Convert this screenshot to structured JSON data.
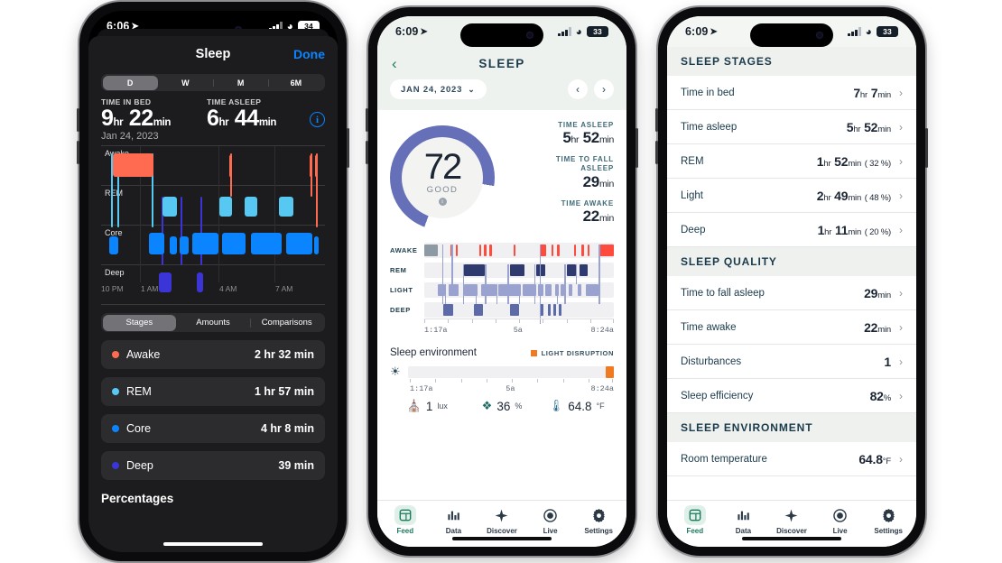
{
  "phone1": {
    "status": {
      "time": "6:06",
      "location_icon": "location-arrow-icon",
      "signal_icon": "cellular-bars-icon",
      "wifi_icon": "wifi-icon",
      "battery": "34"
    },
    "nav": {
      "title": "Sleep",
      "done_label": "Done"
    },
    "segmented": {
      "options": [
        "D",
        "W",
        "M",
        "6M"
      ],
      "selected": "D"
    },
    "stats": [
      {
        "label": "TIME IN BED",
        "hours": "9",
        "hr_unit": "hr",
        "minutes": "22",
        "min_unit": "min"
      },
      {
        "label": "TIME ASLEEP",
        "hours": "6",
        "hr_unit": "hr",
        "minutes": "44",
        "min_unit": "min"
      }
    ],
    "info_icon": "info-circle-icon",
    "date": "Jan 24, 2023",
    "chart": {
      "rows": [
        "Awake",
        "REM",
        "Core",
        "Deep"
      ],
      "xticks": [
        "10 PM",
        "1 AM",
        "4 AM",
        "7 AM"
      ]
    },
    "tabs": {
      "options": [
        "Stages",
        "Amounts",
        "Comparisons"
      ],
      "selected": "Stages"
    },
    "legend_rows": [
      {
        "name": "Awake",
        "value": "2 hr 32 min",
        "color": "#ff6b51"
      },
      {
        "name": "REM",
        "value": "1 hr 57 min",
        "color": "#57c8f2"
      },
      {
        "name": "Core",
        "value": "4 hr 8 min",
        "color": "#0a84ff"
      },
      {
        "name": "Deep",
        "value": "39 min",
        "color": "#3b34d6"
      }
    ],
    "footer": "Percentages"
  },
  "phone2": {
    "status": {
      "time": "6:09",
      "battery": "33"
    },
    "nav": {
      "back_icon": "chevron-left-icon",
      "title": "SLEEP"
    },
    "date_pill": {
      "label": "JAN 24, 2023",
      "chevron_icon": "chevron-down-icon"
    },
    "nav_prev_icon": "chevron-left-icon",
    "nav_next_icon": "chevron-right-icon",
    "score": {
      "value": "72",
      "quality": "GOOD",
      "info_icon": "info-circle-icon",
      "percent": 72
    },
    "side_stats": [
      {
        "label": "TIME ASLEEP",
        "hours": "5",
        "hr_unit": "hr",
        "minutes": "52",
        "min_unit": "min"
      },
      {
        "label": "TIME TO FALL ASLEEP",
        "hours": "",
        "hr_unit": "",
        "minutes": "29",
        "min_unit": "min"
      },
      {
        "label": "TIME AWAKE",
        "hours": "",
        "hr_unit": "",
        "minutes": "22",
        "min_unit": "min"
      }
    ],
    "hypnogram": {
      "rows": [
        "AWAKE",
        "REM",
        "LIGHT",
        "DEEP"
      ],
      "start_label": "1:17a",
      "mid_label": "5a",
      "end_label": "8:24a",
      "colors": {
        "awake_gray": "#8e9aa3",
        "awake_red": "#ff4b3e",
        "rem": "#2f3a6e",
        "light": "#9aa3d0",
        "deep": "#5c6aa8"
      }
    },
    "environment": {
      "title": "Sleep environment",
      "legend_label": "LIGHT DISRUPTION",
      "legend_color": "#f07a21",
      "sun_icon": "sun-icon",
      "start_label": "1:17a",
      "mid_label": "5a",
      "end_label": "8:24a",
      "values": [
        {
          "icon": "lux-icon",
          "value": "1",
          "unit": "lux"
        },
        {
          "icon": "humidity-icon",
          "value": "36",
          "unit": "%"
        },
        {
          "icon": "thermometer-icon",
          "value": "64.8",
          "unit": "°F"
        }
      ]
    },
    "tabbar": [
      {
        "label": "Feed",
        "icon": "feed-icon",
        "active": true
      },
      {
        "label": "Data",
        "icon": "bar-chart-icon",
        "active": false
      },
      {
        "label": "Discover",
        "icon": "sparkle-icon",
        "active": false
      },
      {
        "label": "Live",
        "icon": "record-circle-icon",
        "active": false
      },
      {
        "label": "Settings",
        "icon": "gear-icon",
        "active": false
      }
    ]
  },
  "phone3": {
    "status": {
      "time": "6:09",
      "battery": "33"
    },
    "sections": [
      {
        "title": "SLEEP STAGES",
        "rows": [
          {
            "key": "Time in bed",
            "hours": "7",
            "hr": "hr",
            "minutes": "7",
            "min": "min",
            "pct": ""
          },
          {
            "key": "Time asleep",
            "hours": "5",
            "hr": "hr",
            "minutes": "52",
            "min": "min",
            "pct": ""
          },
          {
            "key": "REM",
            "hours": "1",
            "hr": "hr",
            "minutes": "52",
            "min": "min",
            "pct": "( 32 %)"
          },
          {
            "key": "Light",
            "hours": "2",
            "hr": "hr",
            "minutes": "49",
            "min": "min",
            "pct": "( 48 %)"
          },
          {
            "key": "Deep",
            "hours": "1",
            "hr": "hr",
            "minutes": "11",
            "min": "min",
            "pct": "( 20 %)"
          }
        ]
      },
      {
        "title": "SLEEP QUALITY",
        "rows": [
          {
            "key": "Time to fall asleep",
            "hours": "",
            "hr": "",
            "minutes": "29",
            "min": "min",
            "pct": ""
          },
          {
            "key": "Time awake",
            "hours": "",
            "hr": "",
            "minutes": "22",
            "min": "min",
            "pct": ""
          },
          {
            "key": "Disturbances",
            "hours": "",
            "hr": "",
            "minutes": "1",
            "min": "",
            "pct": ""
          },
          {
            "key": "Sleep efficiency",
            "hours": "",
            "hr": "",
            "minutes": "82",
            "min": "%",
            "pct": ""
          }
        ]
      },
      {
        "title": "SLEEP ENVIRONMENT",
        "rows": [
          {
            "key": "Room temperature",
            "hours": "",
            "hr": "",
            "minutes": "64.8",
            "min": "°F",
            "pct": ""
          }
        ]
      }
    ],
    "chevron_icon": "chevron-right-icon",
    "tabbar": [
      {
        "label": "Feed",
        "icon": "feed-icon",
        "active": true
      },
      {
        "label": "Data",
        "icon": "bar-chart-icon",
        "active": false
      },
      {
        "label": "Discover",
        "icon": "sparkle-icon",
        "active": false
      },
      {
        "label": "Live",
        "icon": "record-circle-icon",
        "active": false
      },
      {
        "label": "Settings",
        "icon": "gear-icon",
        "active": false
      }
    ]
  }
}
